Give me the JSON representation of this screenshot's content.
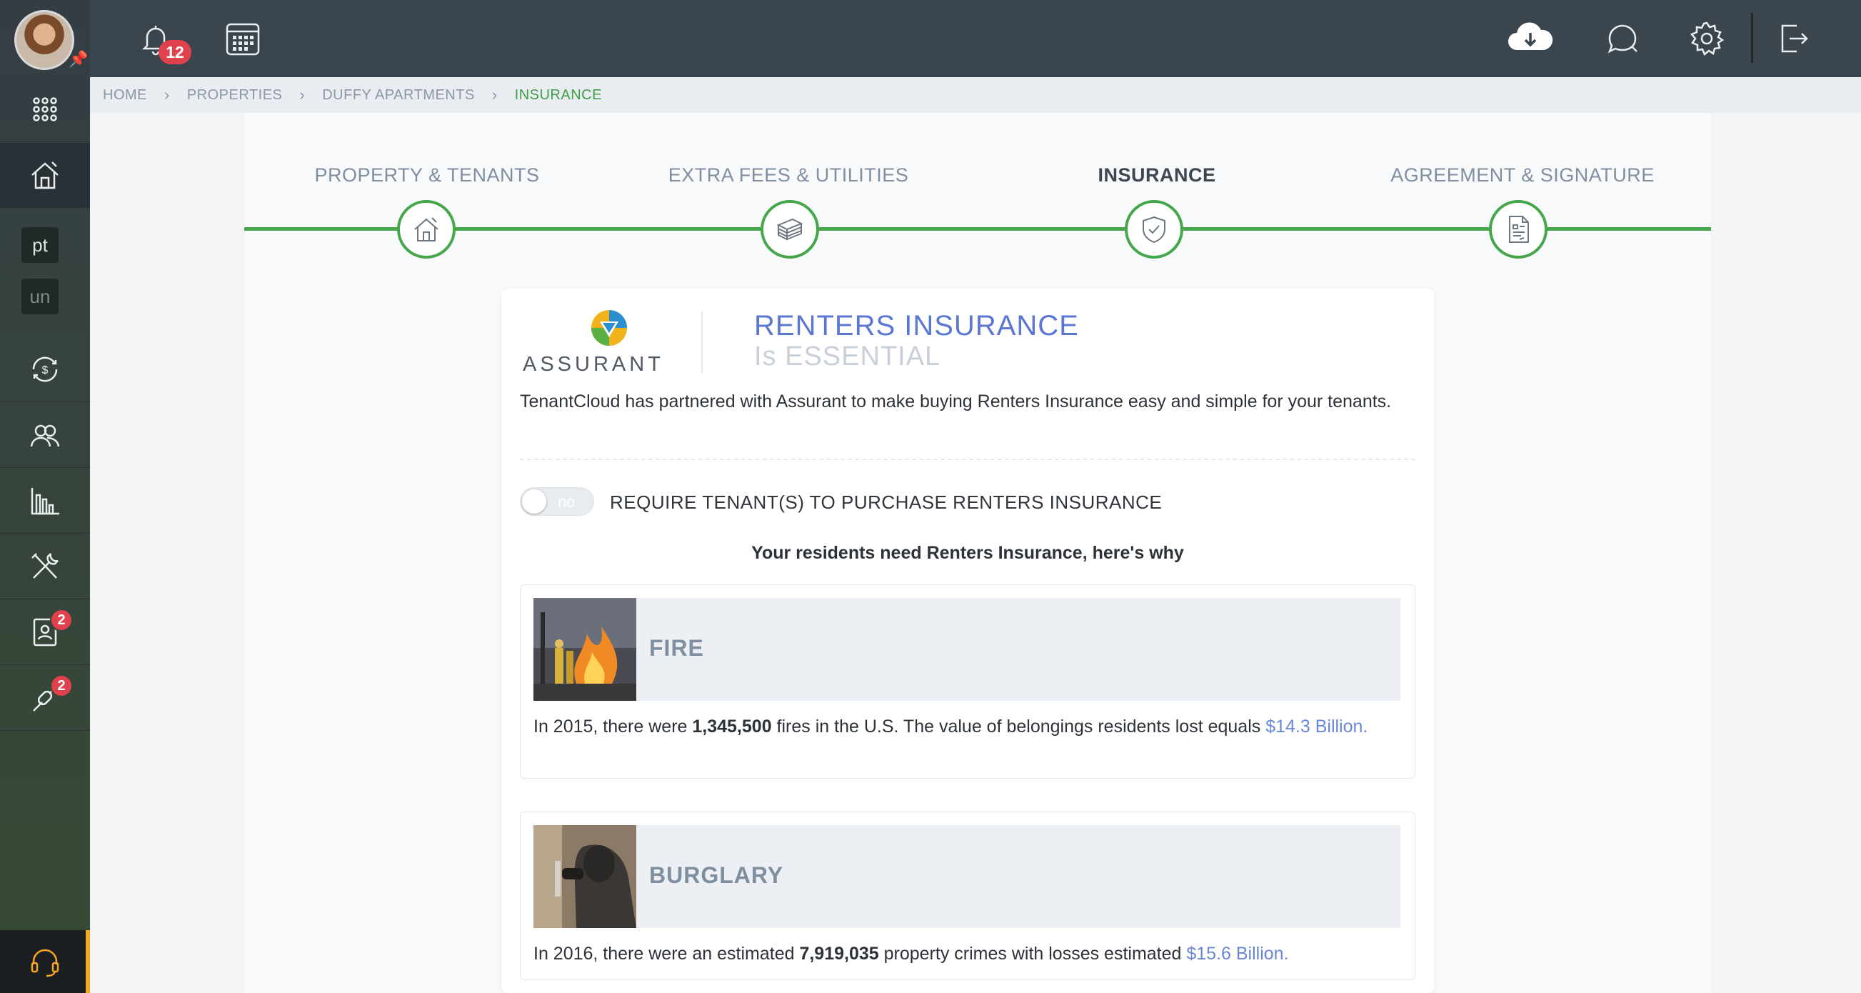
{
  "topbar": {
    "notification_count": "12"
  },
  "sidebar": {
    "box1": "pt",
    "box2": "un",
    "badge_screening": "2",
    "badge_links": "2"
  },
  "breadcrumb": {
    "items": [
      "HOME",
      "PROPERTIES",
      "DUFFY APARTMENTS"
    ],
    "current": "INSURANCE"
  },
  "wizard": {
    "steps": [
      {
        "label": "PROPERTY & TENANTS"
      },
      {
        "label": "EXTRA FEES & UTILITIES"
      },
      {
        "label": "INSURANCE"
      },
      {
        "label": "AGREEMENT & SIGNATURE"
      }
    ],
    "active_step": 2
  },
  "card": {
    "logo_text": "ASSURANT",
    "title_line1": "RENTERS INSURANCE",
    "title_line2": "Is ESSENTIAL",
    "intro": "TenantCloud has partnered with Assurant to make buying Renters Insurance easy and simple for your tenants.",
    "toggle_state": "no",
    "toggle_label": "REQUIRE TENANT(S) TO PURCHASE RENTERS INSURANCE",
    "why_heading": "Your residents need Renters Insurance, here's why",
    "risks": [
      {
        "title": "FIRE",
        "text_before": "In 2015, there were ",
        "count": "1,345,500",
        "text_mid": " fires in the U.S. The value of belongings residents lost equals ",
        "amount": "$14.3 Billion."
      },
      {
        "title": "BURGLARY",
        "text_before": "In 2016, there were an estimated ",
        "count": "7,919,035",
        "text_mid": " property crimes with losses estimated ",
        "amount": "$15.6 Billion."
      }
    ]
  },
  "colors": {
    "accent_green": "#45a64a",
    "title_blue": "#5b77d2",
    "badge_red": "#e0424d"
  }
}
